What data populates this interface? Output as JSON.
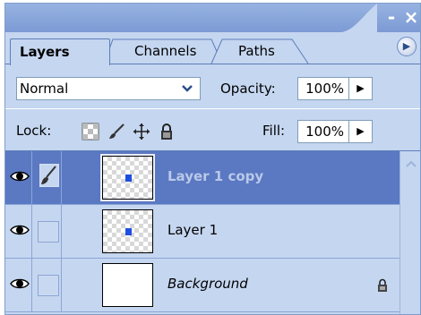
{
  "window": {
    "minimize_label": "-",
    "close_label": "×"
  },
  "tabs": [
    {
      "label": "Layers",
      "active": true
    },
    {
      "label": "Channels",
      "active": false
    },
    {
      "label": "Paths",
      "active": false
    }
  ],
  "blend": {
    "mode": "Normal",
    "opacity_label": "Opacity:",
    "opacity_value": "100%"
  },
  "lock": {
    "label": "Lock:",
    "fill_label": "Fill:",
    "fill_value": "100%"
  },
  "layers": [
    {
      "name": "Layer 1 copy",
      "selected": true,
      "visible": true,
      "linked_brush": true,
      "thumb": "checker",
      "locked": false
    },
    {
      "name": "Layer 1",
      "selected": false,
      "visible": true,
      "linked_brush": false,
      "thumb": "checker",
      "locked": false
    },
    {
      "name": "Background",
      "selected": false,
      "visible": true,
      "linked_brush": false,
      "thumb": "white",
      "locked": true
    }
  ],
  "colors": {
    "panel_bg": "#c5d6f0",
    "selected_row": "#5b78c2",
    "title_bar": "#8aa6da"
  }
}
